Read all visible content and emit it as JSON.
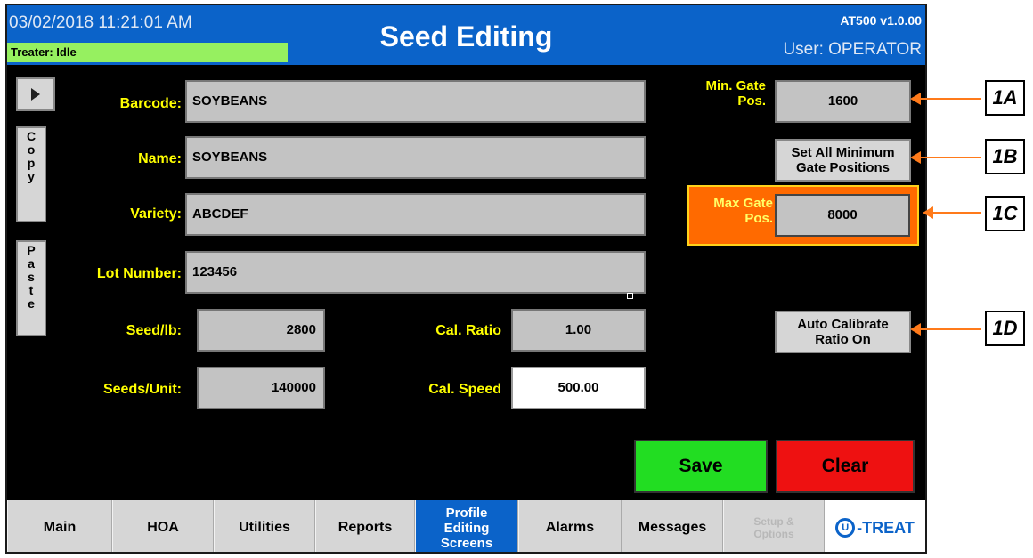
{
  "header": {
    "datetime": "03/02/2018 11:21:01 AM",
    "treater_status": "Treater: Idle",
    "title": "Seed Editing",
    "version": "AT500 v1.0.00",
    "user": "User: OPERATOR"
  },
  "side_buttons": {
    "copy_letters": [
      "C",
      "o",
      "p",
      "y"
    ],
    "paste_letters": [
      "P",
      "a",
      "s",
      "t",
      "e"
    ]
  },
  "form": {
    "barcode_label": "Barcode:",
    "barcode_value": "SOYBEANS",
    "name_label": "Name:",
    "name_value": "SOYBEANS",
    "variety_label": "Variety:",
    "variety_value": "ABCDEF",
    "lot_label": "Lot Number:",
    "lot_value": "123456",
    "seed_lb_label": "Seed/lb:",
    "seed_lb_value": "2800",
    "seeds_unit_label": "Seeds/Unit:",
    "seeds_unit_value": "140000",
    "cal_ratio_label": "Cal. Ratio",
    "cal_ratio_value": "1.00",
    "cal_speed_label": "Cal. Speed",
    "cal_speed_value": "500.00"
  },
  "gate": {
    "min_label_1": "Min. Gate",
    "min_label_2": "Pos.",
    "min_value": "1600",
    "set_all_1": "Set All Minimum",
    "set_all_2": "Gate Positions",
    "max_label_1": "Max Gate",
    "max_label_2": "Pos.",
    "max_value": "8000",
    "auto_cal_1": "Auto Calibrate",
    "auto_cal_2": "Ratio On"
  },
  "actions": {
    "save": "Save",
    "clear": "Clear"
  },
  "colors": {
    "header_blue": "#0b63c9",
    "status_green": "#96f060",
    "label_yellow": "#ffff00",
    "save_green": "#22dd22",
    "clear_red": "#ee1111",
    "max_gate_orange": "#ff6a00",
    "callout_orange": "#ff7a1a"
  },
  "nav": {
    "main": "Main",
    "hoa": "HOA",
    "utilities": "Utilities",
    "reports": "Reports",
    "profile_1": "Profile",
    "profile_2": "Editing",
    "profile_3": "Screens",
    "alarms": "Alarms",
    "messages": "Messages",
    "setup_1": "Setup &",
    "setup_2": "Options",
    "logo_text": "-TREAT"
  },
  "callouts": {
    "a": "1A",
    "b": "1B",
    "c": "1C",
    "d": "1D"
  }
}
